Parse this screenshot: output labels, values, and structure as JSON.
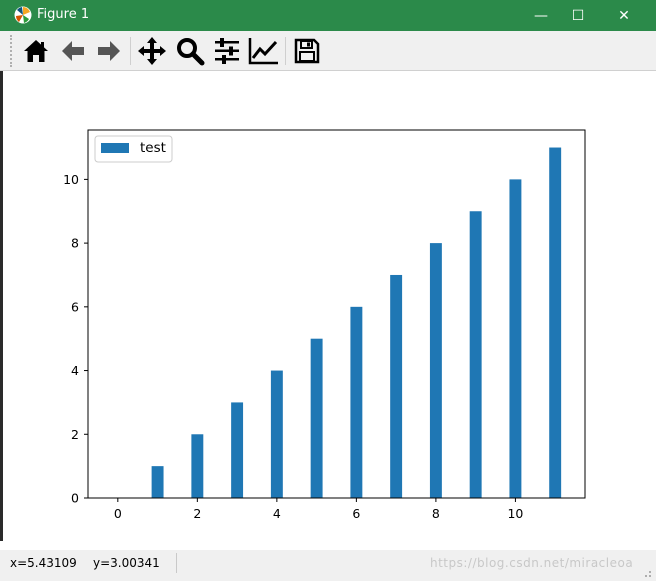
{
  "window": {
    "title": "Figure 1",
    "minimize": "—",
    "maximize": "☐",
    "close": "✕"
  },
  "toolbar": {
    "buttons": [
      {
        "name": "home",
        "icon": "home-icon"
      },
      {
        "name": "back",
        "icon": "arrow-left-icon"
      },
      {
        "name": "forward",
        "icon": "arrow-right-icon"
      },
      {
        "name": "pan",
        "icon": "move-icon"
      },
      {
        "name": "zoom",
        "icon": "magnifier-icon"
      },
      {
        "name": "configure-subplots",
        "icon": "sliders-icon"
      },
      {
        "name": "edit-axis",
        "icon": "line-chart-icon"
      },
      {
        "name": "save",
        "icon": "floppy-disk-icon"
      }
    ]
  },
  "status": {
    "x_readout": "x=5.43109",
    "y_readout": "y=3.00341",
    "watermark": "https://blog.csdn.net/miracleoa"
  },
  "colors": {
    "titlebar": "#2b8a4a",
    "bar": "#1f77b4",
    "toolbar_bg": "#f0f0f0"
  },
  "chart_data": {
    "type": "bar",
    "x": [
      0,
      1,
      2,
      3,
      4,
      5,
      6,
      7,
      8,
      9,
      10,
      11
    ],
    "series": [
      {
        "name": "test",
        "values": [
          0,
          1,
          2,
          3,
          4,
          5,
          6,
          7,
          8,
          9,
          10,
          11
        ]
      }
    ],
    "bar_width": 0.3,
    "xticks": [
      0,
      2,
      4,
      6,
      8,
      10
    ],
    "yticks": [
      0,
      2,
      4,
      6,
      8,
      10
    ],
    "xlim": [
      -0.75,
      11.75
    ],
    "ylim": [
      0,
      11.55
    ],
    "legend": "upper-left",
    "grid": false,
    "title": "",
    "xlabel": "",
    "ylabel": ""
  }
}
